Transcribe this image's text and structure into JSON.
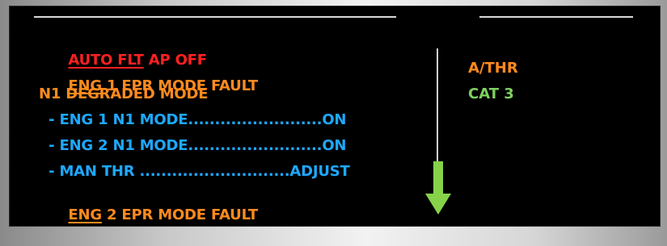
{
  "ecam": {
    "warnings": [
      {
        "title": "AUTO FLT",
        "text": " AP OFF"
      },
      {
        "title": "ENG",
        "text": " 1 EPR MODE FAULT"
      },
      {
        "title": "N1 DEGRADED MODE"
      },
      {
        "action": "  - ENG 1 N1 MODE.........................ON"
      },
      {
        "action": "  - ENG 2 N1 MODE.........................ON"
      },
      {
        "action": "  - MAN THR ............................ADJUST"
      },
      {
        "title": "ENG",
        "text": " 2 EPR MODE FAULT"
      }
    ],
    "status_right": [
      "A/THR",
      "CAT 3"
    ],
    "overflow_arrow_icon": "down-arrow-icon",
    "colors": {
      "warning_red": "#ff2020",
      "caution_amber": "#ff8a1e",
      "action_cyan": "#1ea8ff",
      "status_green": "#7fd060",
      "background": "#000000"
    }
  }
}
